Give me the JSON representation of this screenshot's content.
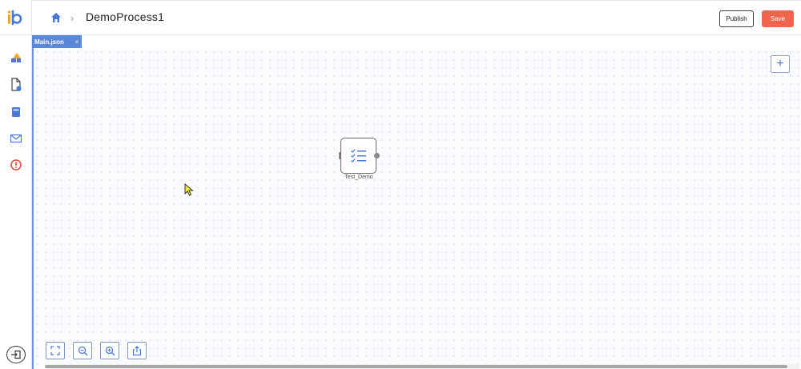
{
  "header": {
    "page_title": "DemoProcess1",
    "breadcrumb_separator": "›",
    "publish_label": "Publish",
    "save_label": "Save"
  },
  "tabs": [
    {
      "label": "Main.json",
      "close": "×",
      "active": true
    }
  ],
  "canvas": {
    "add_label": "+",
    "nodes": [
      {
        "label": "Test_Demo",
        "icon": "checklist-icon"
      }
    ]
  },
  "sidebar": {
    "icons": [
      "logo-icon",
      "shapes-icon",
      "document-settings-icon",
      "storage-icon",
      "mail-icon",
      "alert-icon",
      "exit-icon"
    ]
  },
  "toolbar": {
    "icons": [
      "fit-screen-icon",
      "zoom-out-icon",
      "zoom-in-icon",
      "export-icon"
    ]
  },
  "colors": {
    "accent_blue": "#5b87d9",
    "save_button": "#f0634c",
    "alert_red": "#e0473a",
    "logo_orange": "#f5a623"
  }
}
